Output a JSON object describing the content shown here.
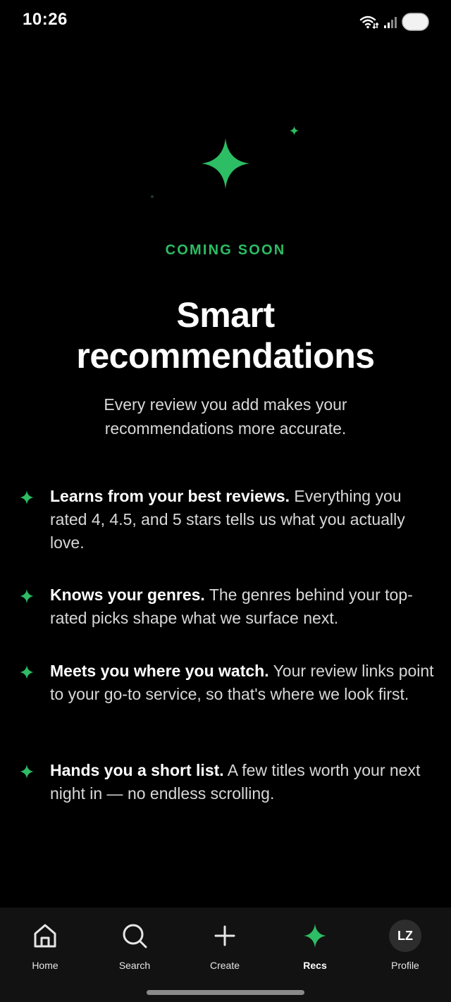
{
  "status_bar": {
    "time": "10:26",
    "icons": [
      "wifi-icon",
      "signal-icon",
      "battery-icon"
    ]
  },
  "hero": {
    "eyebrow": "COMING SOON",
    "title_line1": "Smart",
    "title_line2": "recommendations",
    "subtitle_line1": "Every review you add makes your",
    "subtitle_line2": "recommendations more accurate.",
    "accent_color": "#2dbd64"
  },
  "features": [
    {
      "title": "Learns from your best reviews.",
      "body": "Everything you rated 4, 4.5, and 5 stars tells us what you actually love."
    },
    {
      "title": "Knows your genres.",
      "body": "The genres behind your top-rated picks shape what we surface next."
    },
    {
      "title": "Meets you where you watch.",
      "body": "Your review links point to your go-to service, so that's where we look first."
    },
    {
      "title": "Hands you a short list.",
      "body": "A few titles worth your next night in — no endless scrolling."
    }
  ],
  "nav": {
    "items": [
      {
        "label": "Home",
        "icon": "home-icon"
      },
      {
        "label": "Search",
        "icon": "search-icon"
      },
      {
        "label": "Create",
        "icon": "plus-icon"
      },
      {
        "label": "Recs",
        "icon": "sparkle-icon",
        "active": true
      },
      {
        "label": "Profile",
        "icon": "avatar",
        "initials": "LZ"
      }
    ]
  }
}
